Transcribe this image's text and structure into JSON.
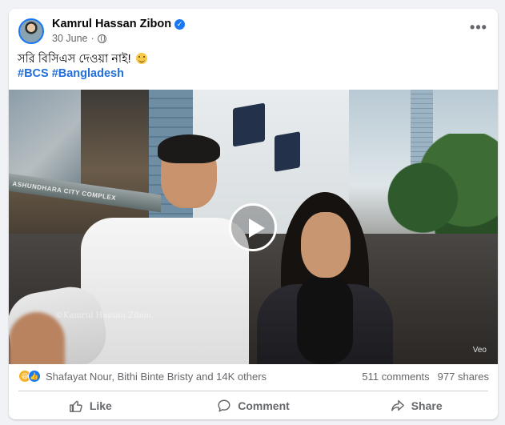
{
  "post": {
    "author": "Kamrul Hassan Zibon",
    "date": "30 June",
    "text": "সরি বিসিএস দেওয়া নাই!",
    "hashtags": [
      "#BCS",
      "#Bangladesh"
    ],
    "more_label": "•••"
  },
  "video": {
    "watermark": "©Kamrul Hassan Zibon",
    "veo_label": "Veo",
    "mall_sign": "ASHUNDHARA CITY COMPLEX"
  },
  "stats": {
    "reactors": "Shafayat Nour, Bithi Binte Bristy and 14K others",
    "comments": "511 comments",
    "shares": "977 shares"
  },
  "actions": {
    "like": "Like",
    "comment": "Comment",
    "share": "Share"
  },
  "colors": {
    "accent": "#1877f2",
    "hashtag": "#216fdb",
    "muted": "#65676b"
  }
}
